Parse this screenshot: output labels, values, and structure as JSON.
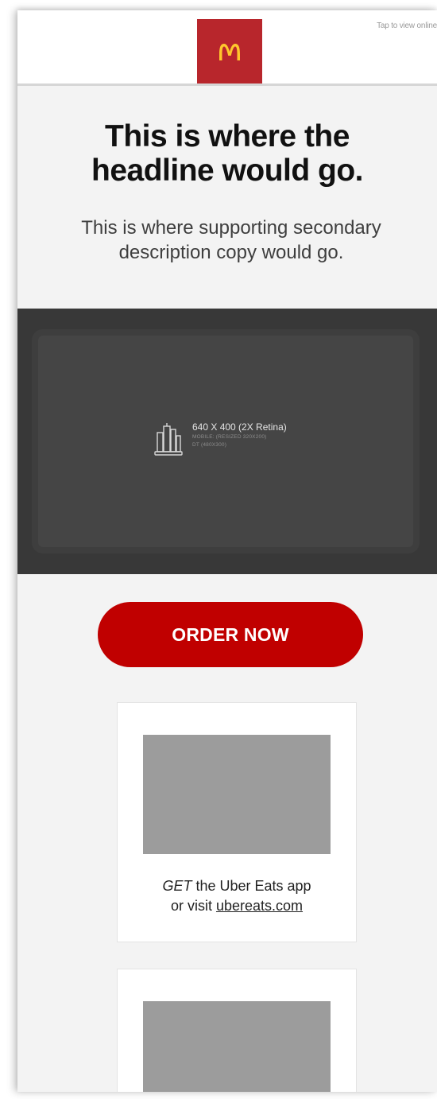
{
  "header": {
    "tap_link": "Tap to view online",
    "logo_icon": "mcdonalds-arches-icon",
    "logo_bg": "#b8262c",
    "arches_color": "#ffc72c"
  },
  "hero_copy": {
    "headline_line1": "This is where the",
    "headline_line2": "headline would go.",
    "description": "This is where supporting secondary description copy would go."
  },
  "hero_image": {
    "icon": "buildings-laptop-icon",
    "dimensions": "640 X 400 (2X Retina)",
    "mobile_note": "MOBILE: (RESIZED 320X200)",
    "desktop_note": "DT (480X300)"
  },
  "cta": {
    "label": "ORDER NOW",
    "color": "#c00000"
  },
  "cards": [
    {
      "italic_verb": "GET",
      "text_rest": " the Uber Eats app",
      "text_line2_prefix": "or visit ",
      "link_text": "ubereats.com"
    }
  ]
}
